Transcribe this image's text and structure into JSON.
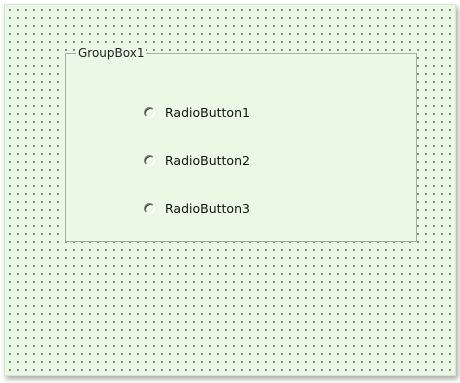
{
  "form": {
    "groupbox": {
      "caption": "GroupBox1",
      "radio_buttons": [
        {
          "label": "RadioButton1",
          "checked": false
        },
        {
          "label": "RadioButton2",
          "checked": false
        },
        {
          "label": "RadioButton3",
          "checked": false
        }
      ]
    },
    "colors": {
      "canvas_background": "#e9f9e5",
      "grid_dots": "#4f5f4f",
      "groupbox_border": "#a7aba3"
    }
  }
}
